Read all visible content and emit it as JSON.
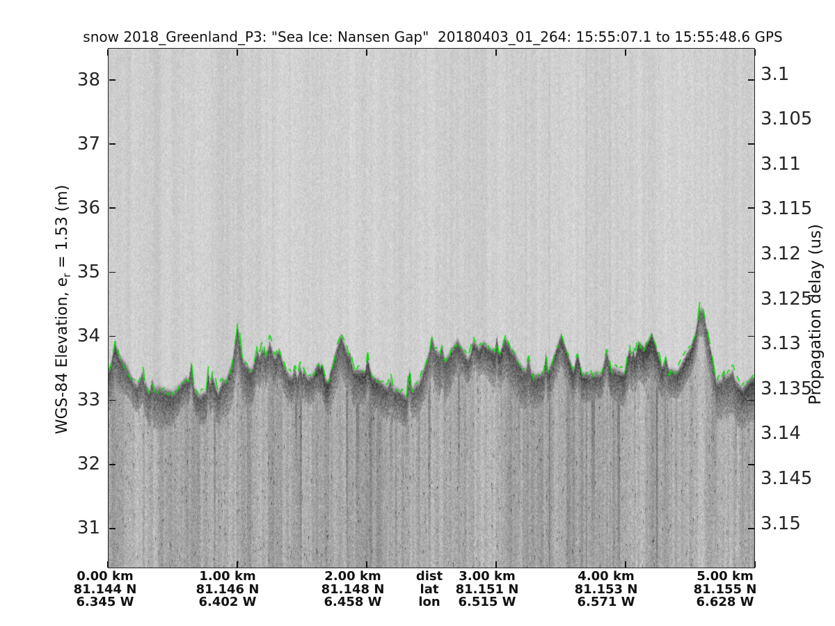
{
  "chart_data": {
    "type": "heatmap",
    "subtype": "radar_echogram",
    "title": "snow 2018_Greenland_P3: \"Sea Ice: Nansen Gap\"  20180403_01_264: 15:55:07.1 to 15:55:48.6 GPS",
    "grid": false,
    "y_left": {
      "label": "WGS-84 Elevation, e_r = 1.53 (m)",
      "label_pre": "WGS-84 Elevation, e",
      "label_sub": "r",
      "label_post": " = 1.53 (m)",
      "ticks": [
        38,
        37,
        36,
        35,
        34,
        33,
        32,
        31
      ],
      "ylim": [
        30.38,
        38.5
      ],
      "unit": "m"
    },
    "y_right": {
      "label": "Propagation delay (us)",
      "ticks": [
        3.1,
        3.105,
        3.11,
        3.115,
        3.12,
        3.125,
        3.13,
        3.135,
        3.14,
        3.145,
        3.15
      ],
      "ylim": [
        3.097,
        3.155
      ],
      "unit": "us"
    },
    "x_axis": {
      "xlim_km": [
        0,
        5
      ],
      "row_headers": [
        "dist",
        "lat",
        "lon"
      ],
      "dist_labels": [
        "0.00 km",
        "1.00 km",
        "2.00 km",
        "3.00 km",
        "4.00 km",
        "5.00 km"
      ],
      "lat_labels": [
        "81.144 N",
        "81.146 N",
        "81.148 N",
        "81.151 N",
        "81.153 N",
        "81.155 N"
      ],
      "lon_labels": [
        "6.345 W",
        "6.402 W",
        "6.458 W",
        "6.515 W",
        "6.571 W",
        "6.628 W"
      ]
    },
    "surface_line": {
      "name": "tracked-surface",
      "color": "#00dd00",
      "x_km": [
        0.0,
        0.1,
        0.2,
        0.3,
        0.4,
        0.5,
        0.6,
        0.7,
        0.8,
        0.9,
        1.0,
        1.1,
        1.2,
        1.3,
        1.4,
        1.5,
        1.6,
        1.7,
        1.8,
        1.9,
        2.0,
        2.1,
        2.2,
        2.3,
        2.4,
        2.5,
        2.6,
        2.7,
        2.8,
        2.9,
        3.0,
        3.1,
        3.2,
        3.3,
        3.4,
        3.5,
        3.6,
        3.7,
        3.8,
        3.9,
        4.0,
        4.1,
        4.2,
        4.3,
        4.4,
        4.5,
        4.6,
        4.7,
        4.8,
        4.9,
        5.0
      ],
      "elevation_m": [
        33.5,
        33.65,
        33.3,
        33.1,
        33.2,
        33.1,
        33.35,
        33.15,
        33.1,
        33.25,
        33.8,
        33.5,
        33.65,
        33.7,
        33.45,
        33.3,
        33.45,
        33.3,
        34.05,
        33.5,
        33.45,
        33.3,
        33.2,
        33.1,
        33.25,
        33.9,
        33.6,
        33.95,
        33.6,
        33.9,
        33.75,
        33.85,
        33.5,
        33.35,
        33.45,
        34.0,
        33.4,
        33.45,
        33.4,
        33.5,
        33.45,
        33.6,
        34.1,
        33.4,
        33.5,
        33.85,
        34.45,
        33.3,
        33.45,
        33.2,
        33.35
      ]
    },
    "echogram_style": {
      "air_gray": "#cfcfcf",
      "surface_band_gray": "#6e6e6e",
      "subsurface_gray": "#a6a6a6",
      "frame_color": "#222222",
      "noise_seed": 987654321
    }
  }
}
